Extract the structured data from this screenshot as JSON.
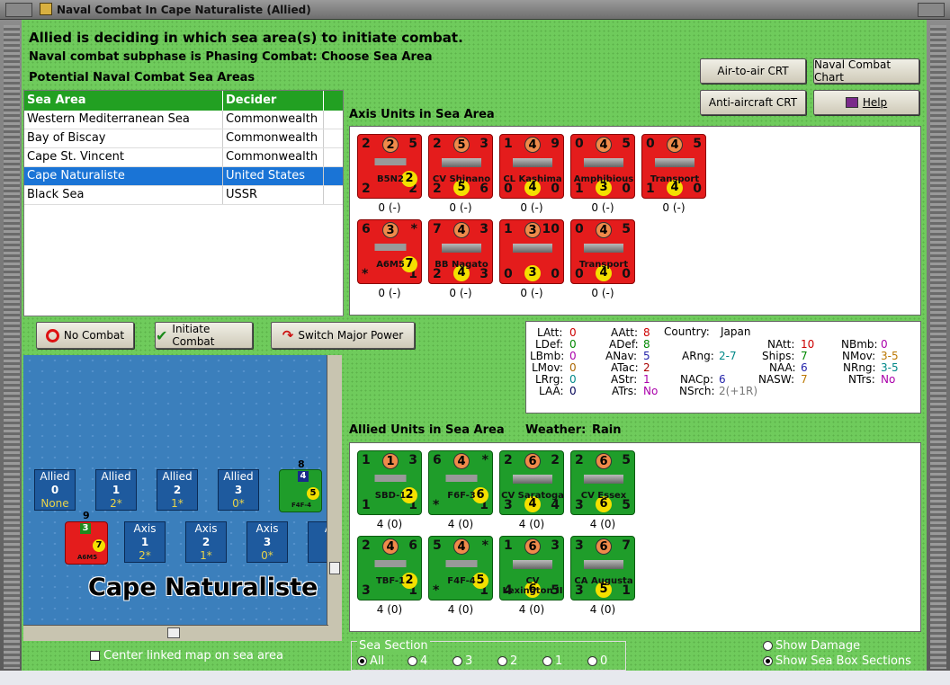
{
  "window": {
    "title": "Naval Combat In Cape Naturaliste (Allied)"
  },
  "header": {
    "line1": "Allied is deciding in which sea area(s) to initiate combat.",
    "line2": "Naval combat subphase is Phasing Combat: Choose Sea Area",
    "line3": "Potential Naval Combat Sea Areas"
  },
  "sea_table": {
    "col_area": "Sea Area",
    "col_decider": "Decider",
    "rows": [
      {
        "area": "Western Mediterranean Sea",
        "decider": "Commonwealth"
      },
      {
        "area": "Bay of Biscay",
        "decider": "Commonwealth"
      },
      {
        "area": "Cape St. Vincent",
        "decider": "Commonwealth"
      },
      {
        "area": "Cape Naturaliste",
        "decider": "United States"
      },
      {
        "area": "Black Sea",
        "decider": "USSR"
      }
    ]
  },
  "buttons": {
    "air_to_air": "Air-to-air CRT",
    "naval_chart": "Naval Combat Chart",
    "anti_aircraft": "Anti-aircraft CRT",
    "help": "Help",
    "no_combat": "No Combat",
    "initiate_combat": "Initiate Combat",
    "switch_power": "Switch Major Power"
  },
  "axis_panel": {
    "title": "Axis Units in Sea Area",
    "units": [
      {
        "name": "B5N2",
        "tl": "2",
        "tm": "2",
        "tr": "5",
        "bl": "2",
        "bm": "",
        "br": "2",
        "extra": "2",
        "cap": "0 (-)",
        "kind": "air"
      },
      {
        "name": "CV Shinano",
        "tl": "2",
        "tm": "5",
        "tr": "3",
        "bl": "2",
        "bm": "5",
        "br": "6",
        "cap": "0 (-)",
        "kind": "ship"
      },
      {
        "name": "CL Kashima",
        "tl": "1",
        "tm": "4",
        "tr": "9",
        "bl": "0",
        "bm": "4",
        "br": "0",
        "cap": "0 (-)",
        "kind": "ship"
      },
      {
        "name": "Amphibious",
        "tl": "0",
        "tm": "4",
        "tr": "5",
        "bl": "1",
        "bm": "3",
        "br": "0",
        "cap": "0 (-)",
        "kind": "ship"
      },
      {
        "name": "Transport",
        "tl": "0",
        "tm": "4",
        "tr": "5",
        "bl": "1",
        "bm": "4",
        "br": "0",
        "cap": "0 (-)",
        "kind": "ship"
      },
      {
        "name": "A6M5",
        "tl": "6",
        "tm": "3",
        "tr": "*",
        "bl": "*",
        "bm": "",
        "br": "1",
        "extra": "7",
        "cap": "0 (-)",
        "kind": "air"
      },
      {
        "name": "BB Nagato",
        "tl": "7",
        "tm": "4",
        "tr": "3",
        "bl": "2",
        "bm": "4",
        "br": "3",
        "cap": "0 (-)",
        "kind": "ship"
      },
      {
        "name": "",
        "tl": "1",
        "tm": "3",
        "tr": "10",
        "bl": "0",
        "bm": "3",
        "br": "0",
        "cap": "0 (-)",
        "kind": "ship"
      },
      {
        "name": "Transport",
        "tl": "0",
        "tm": "4",
        "tr": "5",
        "bl": "0",
        "bm": "4",
        "br": "0",
        "cap": "0 (-)",
        "kind": "ship"
      }
    ]
  },
  "stats": {
    "latt": "LAtt:",
    "latt_v": "0",
    "ldef": "LDef:",
    "ldef_v": "0",
    "lbmb": "LBmb:",
    "lbmb_v": "0",
    "lmov": "LMov:",
    "lmov_v": "0",
    "lrg": "LRrg:",
    "lrg_v": "0",
    "laa": "LAA:",
    "laa_v": "0",
    "aatt": "AAtt:",
    "aatt_v": "8",
    "adef": "ADef:",
    "adef_v": "8",
    "anav": "ANav:",
    "anav_v": "5",
    "atac": "ATac:",
    "atac_v": "2",
    "astr": "AStr:",
    "astr_v": "1",
    "atrs": "ATrs:",
    "atrs_v": "No",
    "country_label": "Country:",
    "country": "Japan",
    "arng": "ARng:",
    "arng_v": "2-7",
    "nacp": "NACp:",
    "nacp_v": "6",
    "nsrch": "NSrch:",
    "nsrch_v": "2(+1R)",
    "natt": "NAtt:",
    "natt_v": "10",
    "ships": "Ships:",
    "ships_v": "7",
    "naa": "NAA:",
    "naa_v": "6",
    "nasw": "NASW:",
    "nasw_v": "7",
    "nbmb": "NBmb:",
    "nbmb_v": "0",
    "nmov": "NMov:",
    "nmov_v": "3-5",
    "nrng": "NRng:",
    "nrng_v": "3-5",
    "ntrs": "NTrs:",
    "ntrs_v": "No"
  },
  "allied_panel": {
    "title": "Allied Units in Sea Area",
    "weather_label": "Weather:",
    "weather": "Rain",
    "units": [
      {
        "name": "SBD-1",
        "tl": "1",
        "tm": "1",
        "tr": "3",
        "bl": "1",
        "br": "1",
        "extra": "2",
        "cap": "4 (0)",
        "kind": "air"
      },
      {
        "name": "F6F-3",
        "tl": "6",
        "tm": "4",
        "tr": "*",
        "bl": "*",
        "br": "1",
        "extra": "6",
        "cap": "4 (0)",
        "kind": "air"
      },
      {
        "name": "CV Saratoga",
        "tl": "2",
        "tm": "6",
        "tr": "2",
        "bl": "3",
        "bm": "4",
        "br": "4",
        "cap": "4 (0)",
        "kind": "ship"
      },
      {
        "name": "CV Essex",
        "tl": "2",
        "tm": "6",
        "tr": "5",
        "bl": "3",
        "bm": "6",
        "br": "5",
        "cap": "4 (0)",
        "kind": "ship"
      },
      {
        "name": "TBF-1",
        "tl": "2",
        "tm": "4",
        "tr": "6",
        "bl": "3",
        "br": "1",
        "extra": "2",
        "cap": "4 (0)",
        "kind": "air"
      },
      {
        "name": "F4F-4",
        "tl": "5",
        "tm": "4",
        "tr": "*",
        "bl": "*",
        "br": "1",
        "extra": "5",
        "cap": "4 (0)",
        "kind": "air"
      },
      {
        "name": "CV Lexington II",
        "tl": "1",
        "tm": "6",
        "tr": "3",
        "bl": "4",
        "bm": "6",
        "br": "5",
        "cap": "4 (0)",
        "kind": "ship"
      },
      {
        "name": "CA Augusta",
        "tl": "3",
        "tm": "6",
        "tr": "7",
        "bl": "3",
        "bm": "5",
        "br": "1",
        "cap": "4 (0)",
        "kind": "ship"
      }
    ]
  },
  "map": {
    "label": "Cape Naturaliste",
    "allied_boxes": [
      {
        "side": "Allied",
        "num": "0",
        "val": "None"
      },
      {
        "side": "Allied",
        "num": "1",
        "val": "2*"
      },
      {
        "side": "Allied",
        "num": "2",
        "val": "1*"
      },
      {
        "side": "Allied",
        "num": "3",
        "val": "0*"
      }
    ],
    "axis_boxes": [
      {
        "side": "Axis",
        "num": "1",
        "val": "2*"
      },
      {
        "side": "Axis",
        "num": "2",
        "val": "1*"
      },
      {
        "side": "Axis",
        "num": "3",
        "val": "0*"
      },
      {
        "side": "A"
      }
    ],
    "stack_allied_count": "8",
    "stack_axis_count": "9",
    "stack_allied_name": "F4F-4",
    "stack_axis_name": "A6M5"
  },
  "footer": {
    "center_map": "Center linked map on sea area",
    "sea_section_title": "Sea Section",
    "sea_section_options": [
      "All",
      "4",
      "3",
      "2",
      "1",
      "0"
    ],
    "show_damage": "Show Damage",
    "show_sea_box": "Show Sea Box Sections"
  },
  "colors": {
    "grass": "#6fcb5c",
    "red_unit": "#e41c1c",
    "green_unit": "#1f9d2a",
    "select": "#1a74d6"
  }
}
